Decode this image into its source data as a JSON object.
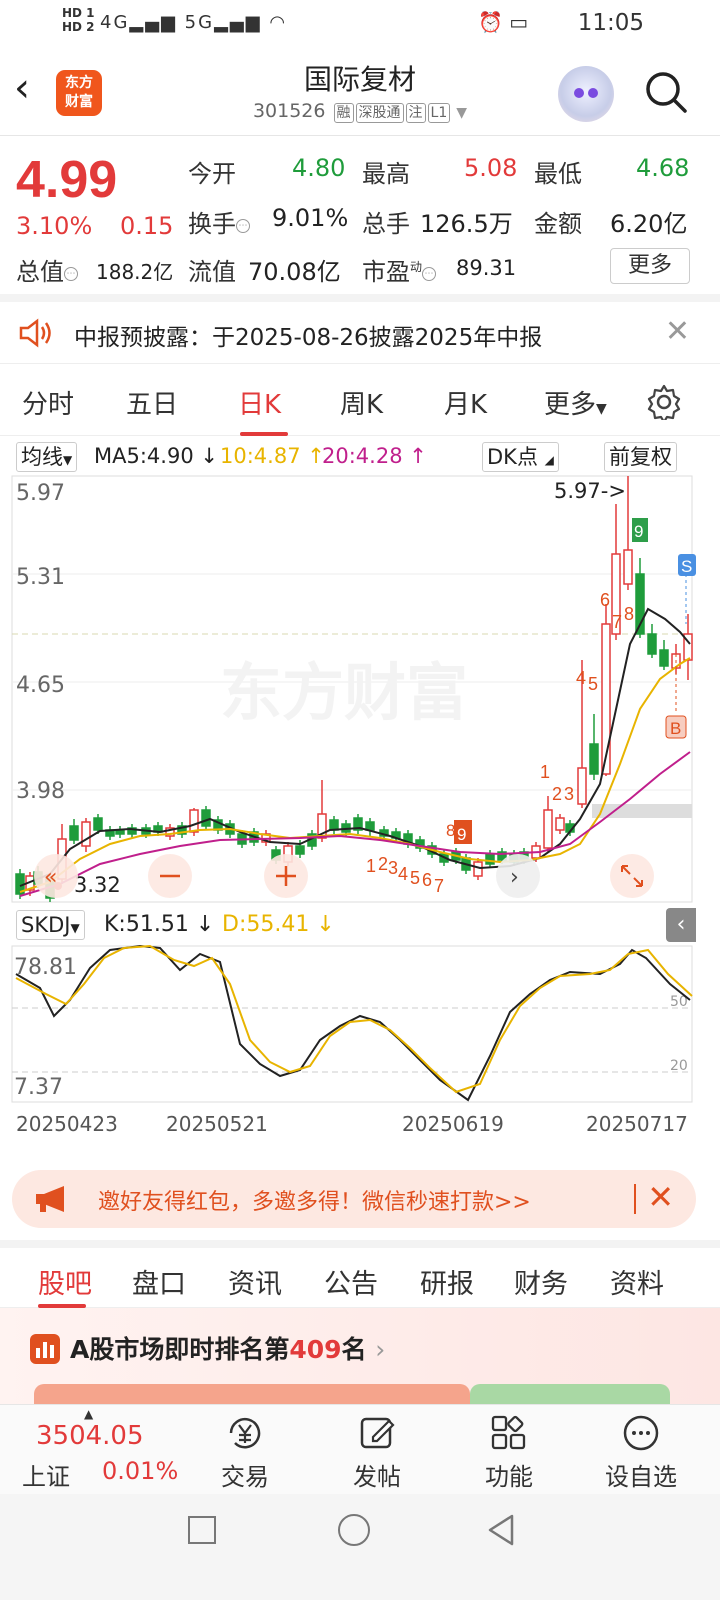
{
  "status_bar": {
    "time": "11:05",
    "hd1": "HD 1",
    "hd2": "HD 2",
    "net1": "4G",
    "net2": "5G"
  },
  "header": {
    "logo_line1": "东方",
    "logo_line2": "财富",
    "stock_name": "国际复材",
    "stock_code": "301526",
    "tags": [
      "融",
      "深股通",
      "注",
      "L1"
    ]
  },
  "quote": {
    "price": "4.99",
    "pct": "3.10%",
    "change": "0.15",
    "fields": {
      "open_label": "今开",
      "open": "4.80",
      "high_label": "最高",
      "high": "5.08",
      "low_label": "最低",
      "low": "4.68",
      "turnover_label": "换手",
      "turnover": "9.01%",
      "volume_label": "总手",
      "volume": "126.5万",
      "amount_label": "金额",
      "amount": "6.20亿",
      "mktcap_label": "总值",
      "mktcap": "188.2亿",
      "float_label": "流值",
      "float": "70.08亿",
      "pe_label": "市盈",
      "pe_sup": "动",
      "pe": "89.31"
    },
    "more_label": "更多"
  },
  "notice": {
    "text": "中报预披露：于2025-08-26披露2025年中报"
  },
  "ktabs": [
    "分时",
    "五日",
    "日K",
    "周K",
    "月K",
    "更多"
  ],
  "ma": {
    "selector": "均线",
    "ma5": "MA5:4.90",
    "ma10": "10:4.87",
    "ma20": "20:4.28",
    "dk_label": "DK点",
    "fq_label": "前复权"
  },
  "kchart": {
    "y_labels": [
      "5.97",
      "5.31",
      "4.65",
      "3.98"
    ],
    "max_label": "5.97->",
    "min_label": "3.32",
    "s_marker": "S",
    "b_marker": "B",
    "nine_marker": "9",
    "seq_digits_a": [
      "1",
      "2",
      "3",
      "4",
      "5",
      "6",
      "7"
    ],
    "seq_digits_b": [
      "1",
      "2",
      "3",
      "4",
      "5",
      "6",
      "7",
      "8"
    ],
    "eight": "8",
    "watermark": "东方财富"
  },
  "skdj": {
    "selector": "SKDJ",
    "k": "K:51.51",
    "d": "D:55.41",
    "y_top": "78.81",
    "y_bottom": "7.37",
    "level_50": "50",
    "level_20": "20"
  },
  "dates": [
    "20250423",
    "20250521",
    "20250619",
    "20250717"
  ],
  "banner": {
    "text": "邀好友得红包，多邀多得！微信秒速打款>>"
  },
  "btabs": [
    "股吧",
    "盘口",
    "资讯",
    "公告",
    "研报",
    "财务",
    "资料"
  ],
  "rank": {
    "prefix": "A股市场即时排名第",
    "num": "409",
    "suffix": "名"
  },
  "bottom_nav": {
    "index_value": "3504.05",
    "index_name": "上证",
    "index_pct": "0.01%",
    "items": [
      "交易",
      "发帖",
      "功能",
      "设自选"
    ]
  },
  "colors": {
    "up": "#e23a3a",
    "down": "#1f9c3b",
    "ma5": "#222222",
    "ma10": "#e8b400",
    "ma20": "#c01f8c",
    "accent": "#f0561c"
  }
}
